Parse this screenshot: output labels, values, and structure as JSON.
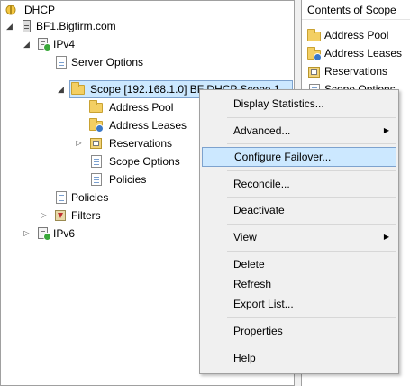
{
  "tree": {
    "root": "DHCP",
    "server": "BF1.Bigfirm.com",
    "ipv4": "IPv4",
    "server_options": "Server Options",
    "scope": "Scope [192.168.1.0] BF DHCP Scope 1",
    "address_pool": "Address Pool",
    "address_leases": "Address Leases",
    "reservations": "Reservations",
    "scope_options": "Scope Options",
    "scope_policies": "Policies",
    "policies": "Policies",
    "filters": "Filters",
    "ipv6": "IPv6"
  },
  "right_pane": {
    "header": "Contents of Scope",
    "items": [
      "Address Pool",
      "Address Leases",
      "Reservations",
      "Scope Options"
    ]
  },
  "menu": {
    "display_statistics": "Display Statistics...",
    "advanced": "Advanced...",
    "configure_failover": "Configure Failover...",
    "reconcile": "Reconcile...",
    "deactivate": "Deactivate",
    "view": "View",
    "delete": "Delete",
    "refresh": "Refresh",
    "export_list": "Export List...",
    "properties": "Properties",
    "help": "Help"
  },
  "icons": {
    "expanded": "expanded-arrow-icon",
    "collapsed": "collapsed-arrow-icon",
    "submenu": "submenu-arrow-icon"
  },
  "colors": {
    "selection_fill": "#cce8ff",
    "selection_border": "#7da2ce",
    "menu_bg": "#f0f0f0"
  }
}
